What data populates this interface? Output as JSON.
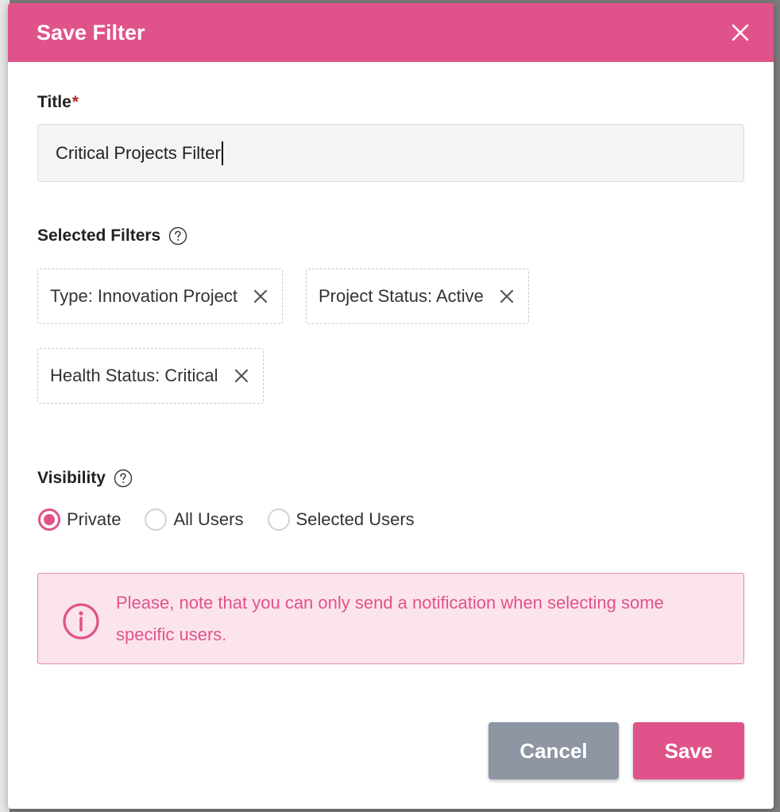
{
  "dialog": {
    "title": "Save Filter",
    "close_icon": "close-icon"
  },
  "title_field": {
    "label": "Title",
    "required_mark": "*",
    "value": "Critical Projects Filter"
  },
  "selected_filters": {
    "label": "Selected Filters",
    "help_icon": "question-circle-icon",
    "chips": [
      {
        "label": "Type: Innovation Project"
      },
      {
        "label": "Project Status: Active"
      },
      {
        "label": "Health Status: Critical"
      }
    ]
  },
  "visibility": {
    "label": "Visibility",
    "help_icon": "question-circle-icon",
    "options": [
      {
        "label": "Private",
        "selected": true
      },
      {
        "label": "All Users",
        "selected": false
      },
      {
        "label": "Selected Users",
        "selected": false
      }
    ]
  },
  "notice": {
    "icon": "info-circle-icon",
    "text_line1": "Please, note that you can only send a notification when selecting some",
    "text_line2": "specific users."
  },
  "buttons": {
    "cancel": "Cancel",
    "save": "Save"
  },
  "colors": {
    "accent": "#e0538a",
    "cancel_bg": "#8e95a3",
    "notice_bg": "#fce4ec"
  }
}
